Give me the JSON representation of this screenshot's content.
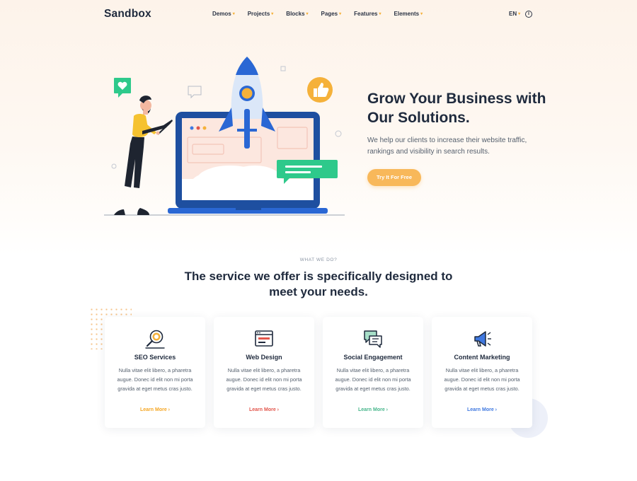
{
  "nav": {
    "logo": "Sandbox",
    "menu": [
      "Demos",
      "Projects",
      "Blocks",
      "Pages",
      "Features",
      "Elements"
    ],
    "lang": "EN",
    "caret": "▾",
    "info_glyph": "i"
  },
  "hero": {
    "title": "Grow Your Business with Our Solutions.",
    "description": "We help our clients to increase their website traffic, rankings and visibility in search results.",
    "cta_label": "Try It For Free"
  },
  "services": {
    "eyebrow": "WHAT WE DO?",
    "title": "The service we offer is specifically designed to meet your needs.",
    "cards": [
      {
        "title": "SEO Services",
        "text": "Nulla vitae elit libero, a pharetra augue. Donec id elit non mi porta gravida at eget metus cras justo.",
        "link": "Learn More ›",
        "icon": "search-magnifier-icon",
        "color": "#f5a623"
      },
      {
        "title": "Web Design",
        "text": "Nulla vitae elit libero, a pharetra augue. Donec id elit non mi porta gravida at eget metus cras justo.",
        "link": "Learn More ›",
        "icon": "browser-window-icon",
        "color": "#e2554b"
      },
      {
        "title": "Social Engagement",
        "text": "Nulla vitae elit libero, a pharetra augue. Donec id elit non mi porta gravida at eget metus cras justo.",
        "link": "Learn More ›",
        "icon": "chat-bubbles-icon",
        "color": "#45b58a"
      },
      {
        "title": "Content Marketing",
        "text": "Nulla vitae elit libero, a pharetra augue. Donec id elit non mi porta gravida at eget metus cras justo.",
        "link": "Learn More ›",
        "icon": "megaphone-icon",
        "color": "#3f78e0"
      }
    ]
  },
  "colors": {
    "accent": "#f8b85a",
    "heading": "#1f2a3d",
    "blue": "#3f78e0",
    "green": "#2ec98b"
  }
}
